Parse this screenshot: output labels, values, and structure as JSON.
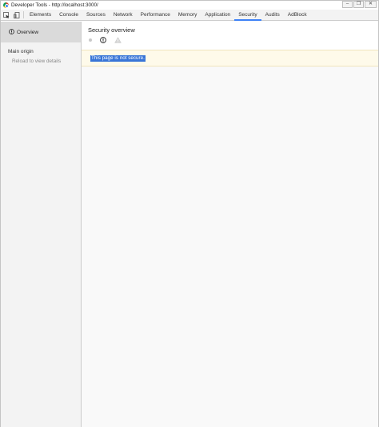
{
  "window": {
    "title": "Developer Tools - http://localhost:3000/",
    "controls": [
      "minimize",
      "restore",
      "close"
    ]
  },
  "toolbar": {
    "icons": [
      "inspect-element-icon",
      "device-mode-icon"
    ],
    "tabs": [
      {
        "label": "Elements",
        "active": false
      },
      {
        "label": "Console",
        "active": false
      },
      {
        "label": "Sources",
        "active": false
      },
      {
        "label": "Network",
        "active": false
      },
      {
        "label": "Performance",
        "active": false
      },
      {
        "label": "Memory",
        "active": false
      },
      {
        "label": "Application",
        "active": false
      },
      {
        "label": "Security",
        "active": true
      },
      {
        "label": "Audits",
        "active": false
      },
      {
        "label": "AdBlock",
        "active": false
      }
    ],
    "accent_color": "#3e82f7"
  },
  "sidebar": {
    "overview_label": "Overview",
    "main_origin_heading": "Main origin",
    "reload_hint": "Reload to view details"
  },
  "main": {
    "title": "Security overview",
    "state_icons": [
      "secure-indicator-icon",
      "info-icon",
      "warning-icon"
    ],
    "summary": "This page is not secure.",
    "summary_highlight_color": "#3875d7"
  }
}
